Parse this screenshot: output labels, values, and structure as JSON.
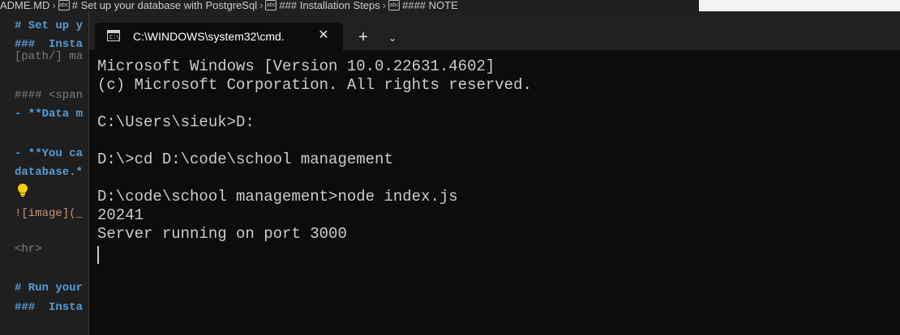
{
  "breadcrumb": {
    "file": "ADME.MD",
    "items": [
      "# Set up your database with PostgreSql",
      "### Installation Steps",
      "#### NOTE"
    ]
  },
  "editor": {
    "lines": [
      {
        "text": "# Set up y",
        "style": "head"
      },
      {
        "text": "###  Insta",
        "style": "head"
      },
      {
        "text": "[path/] ma",
        "style": "dim"
      },
      {
        "text": "#### <span",
        "style": "tag"
      },
      {
        "text": "- **Data m",
        "style": "bold"
      },
      {
        "text": "- **You ca",
        "style": "bold"
      },
      {
        "text": "database.*",
        "style": "bold"
      },
      {
        "text": "![image](_",
        "style": "link"
      },
      {
        "text": "<hr>",
        "style": "tag"
      },
      {
        "text": "# Run your",
        "style": "head"
      },
      {
        "text": "###  Insta",
        "style": "head"
      }
    ]
  },
  "terminal": {
    "tab_title": "C:\\WINDOWS\\system32\\cmd.",
    "icons": {
      "tab": "cmd-icon",
      "close": "close-icon",
      "new_tab": "plus-icon",
      "dropdown": "chevron-down-icon"
    },
    "lines": [
      "Microsoft Windows [Version 10.0.22631.4602]",
      "(c) Microsoft Corporation. All rights reserved.",
      "",
      "C:\\Users\\sieuk>D:",
      "",
      "D:\\>cd D:\\code\\school management",
      "",
      "D:\\code\\school management>node index.js",
      "20241",
      "Server running on port 3000"
    ]
  }
}
